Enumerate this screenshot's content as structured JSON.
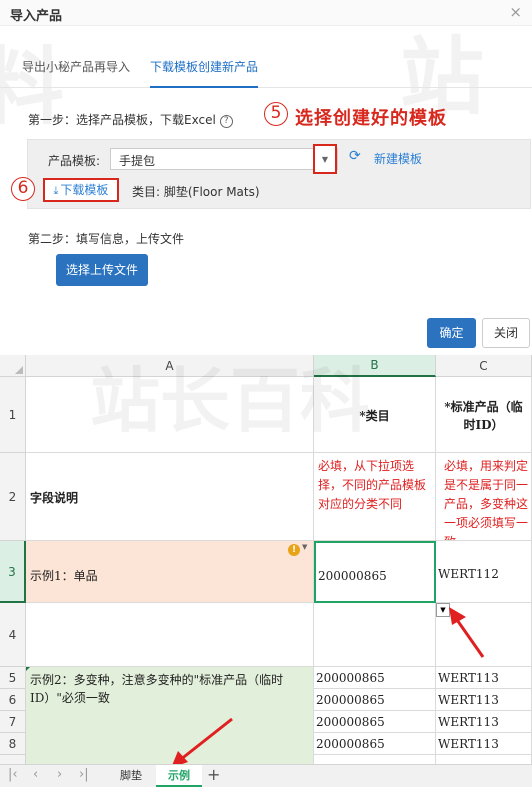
{
  "dialog": {
    "title": "导入产品",
    "close_icon": "close-icon",
    "tabs": [
      {
        "label": "导出小秘产品再导入",
        "active": false
      },
      {
        "label": "下载模板创建新产品",
        "active": true
      }
    ],
    "step1": "第一步：选择产品模板，下载Excel",
    "help_icon": "question-circle-icon",
    "annotation5": {
      "number": "⑤",
      "text": "选择创建好的模板"
    },
    "annotation6": {
      "number": "⑥"
    },
    "template_label": "产品模板:",
    "template_value": "手提包",
    "refresh_icon": "refresh-icon",
    "new_template_link": "新建模板",
    "download_button": "下载模板",
    "category": "类目: 脚垫(Floor Mats)",
    "step2": "第二步：填写信息，上传文件",
    "upload_button": "选择上传文件",
    "ok_button": "确定",
    "close_button": "关闭"
  },
  "sheet": {
    "columns": [
      "A",
      "B",
      "C"
    ],
    "selected_column": "B",
    "selected_row": "3",
    "row_numbers": [
      "1",
      "2",
      "3",
      "4",
      "5",
      "6",
      "7",
      "8"
    ],
    "header_b": "*类目",
    "header_c": "*标准产品（临时ID）",
    "row2": {
      "a": "字段说明",
      "b": "必填，从下拉项选择，不同的产品模板对应的分类不同",
      "c": "必填，用来判定是不是属于同一产品，多变种这一项必须填写一致"
    },
    "row3": {
      "a": "示例1：单品",
      "b": "200000865",
      "c": "WERT112"
    },
    "row5_a": "示例2：多变种，注意多变种的\"标准产品（临时ID）\"必须一致",
    "rows_5_8": [
      {
        "b": "200000865",
        "c": "WERT113"
      },
      {
        "b": "200000865",
        "c": "WERT113"
      },
      {
        "b": "200000865",
        "c": "WERT113"
      },
      {
        "b": "200000865",
        "c": "WERT113"
      }
    ],
    "warning_icon": "warning-circle-icon",
    "dropdown_icon": "dropdown-arrow-icon",
    "tabs": [
      {
        "label": "脚垫",
        "active": false
      },
      {
        "label": "示例",
        "active": true
      }
    ],
    "add_sheet": "+",
    "nav_icons": [
      "first-sheet-icon",
      "prev-sheet-icon",
      "next-sheet-icon",
      "last-sheet-icon"
    ],
    "colors": {
      "row3_fill": "#fce4d6",
      "example2_fill": "#e2efda",
      "note_text": "#e02020",
      "selected": "#217346"
    }
  }
}
